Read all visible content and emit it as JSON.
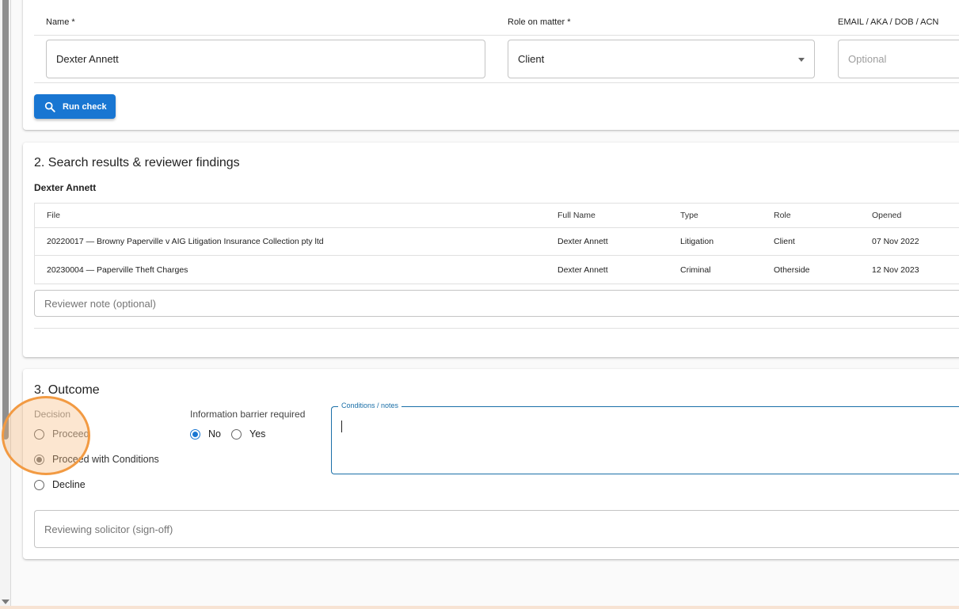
{
  "check_form": {
    "name_label": "Name *",
    "role_label": "Role on matter *",
    "extra_label": "EMAIL / AKA / DOB / ACN",
    "name_value": "Dexter Annett",
    "role_value": "Client",
    "extra_placeholder": "Optional",
    "run_button": "Run check",
    "run_icon": "search-icon"
  },
  "results": {
    "title": "2. Search results & reviewer findings",
    "person": "Dexter Annett",
    "columns": [
      "File",
      "Full Name",
      "Type",
      "Role",
      "Opened"
    ],
    "rows": [
      [
        "20220017 — Browny Paperville v AIG Litigation Insurance Collection pty ltd",
        "Dexter Annett",
        "Litigation",
        "Client",
        "07 Nov 2022"
      ],
      [
        "20230004 — Paperville Theft Charges",
        "Dexter Annett",
        "Criminal",
        "Otherside",
        "12 Nov 2023"
      ]
    ],
    "note_placeholder": "Reviewer note (optional)"
  },
  "outcome": {
    "title": "3. Outcome",
    "decision_label": "Decision",
    "decision_options": [
      "Proceed",
      "Proceed with Conditions",
      "Decline"
    ],
    "decision_selected": "Proceed with Conditions",
    "barrier_label": "Information barrier required",
    "barrier_options": [
      "No",
      "Yes"
    ],
    "barrier_selected": "No",
    "conditions_label": "Conditions / notes",
    "signoff_placeholder": "Reviewing solicitor (sign-off)"
  },
  "colors": {
    "primary": "#1976d2",
    "focus_outline": "#1a6fa8",
    "highlight_ring": "#f29a42"
  }
}
